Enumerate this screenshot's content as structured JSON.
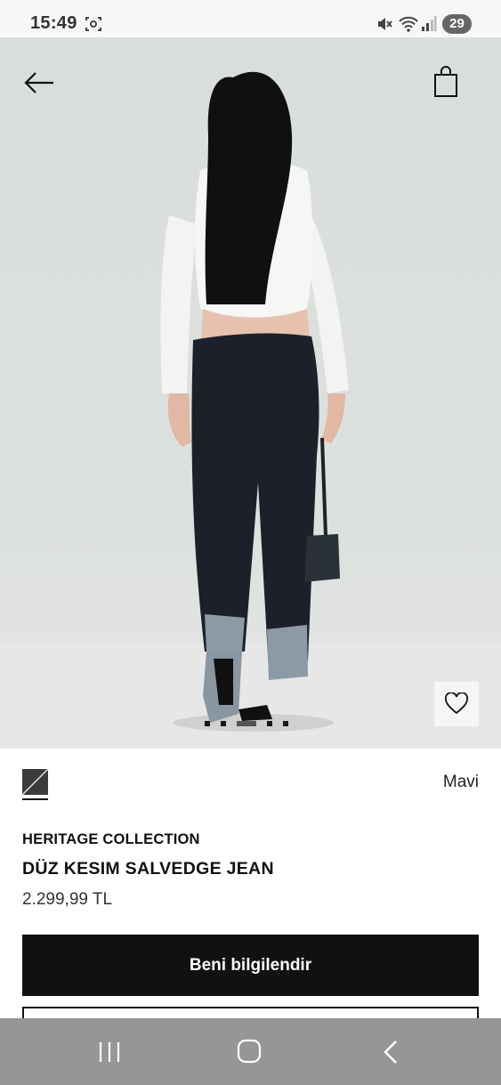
{
  "status_bar": {
    "time": "15:49",
    "battery": "29",
    "icons": [
      "screenshot-icon",
      "mute-icon",
      "wifi-icon",
      "signal-icon"
    ]
  },
  "header": {
    "icons": [
      "arrow-left-icon",
      "shopping-bag-icon"
    ]
  },
  "gallery": {
    "image_description_icon": "model-photo",
    "dot_count": 5,
    "active_dot": 2,
    "favorite_icon": "heart-icon"
  },
  "product": {
    "color_name": "Mavi",
    "collection": "HERITAGE COLLECTION",
    "title": "DÜZ KESIM SALVEDGE JEAN",
    "price": "2.299,99 TL",
    "notify_label": "Beni bilgilendir"
  },
  "colors": {
    "primary_button_bg": "#111111",
    "nav_bar_bg": "#969696",
    "swatch": "#3b3b3b"
  },
  "nav_bar": {
    "icons": [
      "recent-apps-icon",
      "home-icon",
      "back-icon"
    ]
  }
}
